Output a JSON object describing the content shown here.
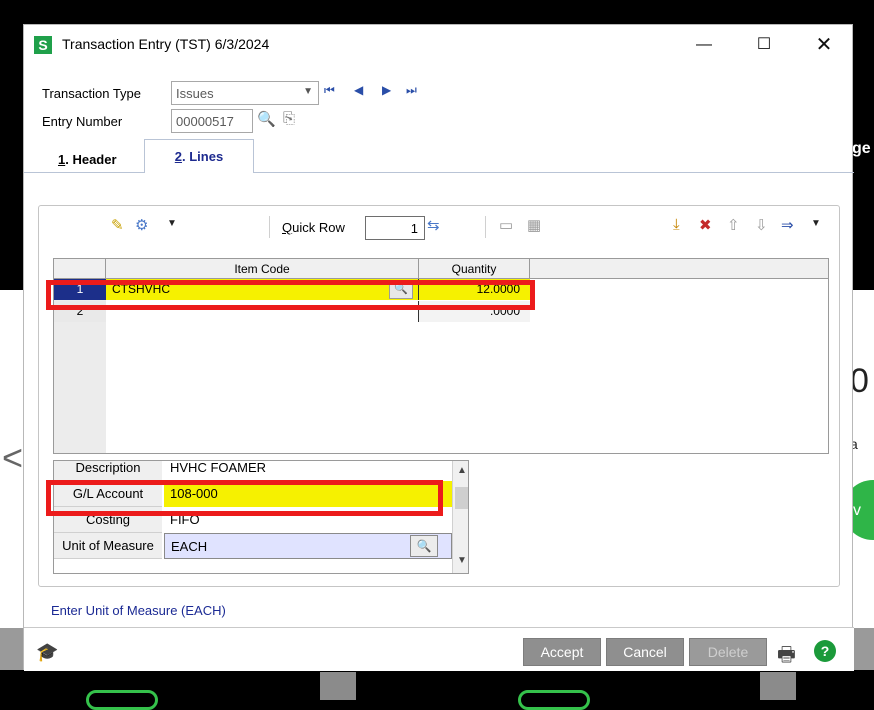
{
  "background": {
    "right_text_top": "ge",
    "right_text_big": "0",
    "right_text_small": "a",
    "right_button_text": "v",
    "left_arrow": "<"
  },
  "window": {
    "app_icon_letter": "S",
    "title": "Transaction Entry (TST) 6/3/2024",
    "minimize": "—",
    "maximize": "☐",
    "close": "✕"
  },
  "header_fields": {
    "transaction_type_label": "Transaction Type",
    "transaction_type_value": "Issues",
    "entry_number_label": "Entry Number",
    "entry_number_value": "00000517"
  },
  "nav": {
    "first": "⏮",
    "prev": "◀",
    "next": "▶",
    "last": "⏭"
  },
  "tabs": [
    {
      "num": "1",
      "label": ". Header"
    },
    {
      "num": "2",
      "label": ". Lines"
    }
  ],
  "toolbar": {
    "quick_row_label": "Quick Row",
    "quick_row_value": "1"
  },
  "grid": {
    "columns": [
      "",
      "Item Code",
      "Quantity"
    ],
    "rows": [
      {
        "num": "1",
        "item_code": "CTSHVHC",
        "quantity": "12.0000"
      },
      {
        "num": "2",
        "item_code": "",
        "quantity": ".0000"
      }
    ]
  },
  "details": [
    {
      "label": "Description",
      "value": "HVHC FOAMER"
    },
    {
      "label": "G/L Account",
      "value": "108-000"
    },
    {
      "label": "Costing",
      "value": "FIFO"
    },
    {
      "label": "Unit of Measure",
      "value": "EACH"
    }
  ],
  "status_text": "Enter Unit of Measure (EACH)",
  "footer": {
    "accept": "Accept",
    "cancel": "Cancel",
    "delete": "Delete",
    "help": "?"
  },
  "colors": {
    "highlight_border": "#ec1b1b",
    "selected_row_fill": "#f6f100",
    "selected_row_number": "#1c2f8a",
    "status_text": "#1b2a94"
  }
}
